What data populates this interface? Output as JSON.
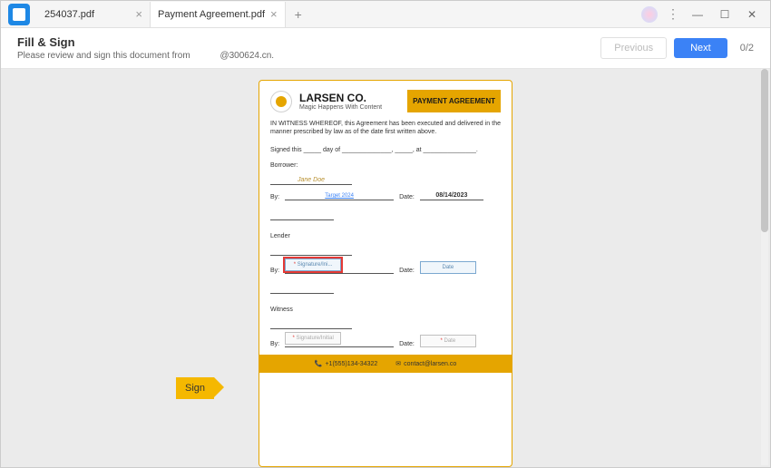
{
  "tabs": [
    {
      "label": "254037.pdf",
      "active": false
    },
    {
      "label": "Payment Agreement.pdf",
      "active": true
    }
  ],
  "header": {
    "title": "Fill & Sign",
    "subtitle_prefix": "Please review and sign this document from",
    "subtitle_suffix": "@300624.cn.",
    "prev_label": "Previous",
    "next_label": "Next",
    "page_count": "0/2"
  },
  "sign_pointer": "Sign",
  "document": {
    "company_name": "LARSEN CO.",
    "tagline": "Magic Happens With Content",
    "badge": "PAYMENT AGREEMENT",
    "intro": "IN WITNESS WHEREOF, this Agreement has been executed and delivered in the manner prescribed by law as of the date first written above.",
    "signed_line": "Signed this _____ day of ______________, _____, at _______________.",
    "borrower_label": "Borrower:",
    "borrower_name": "Jane Doe",
    "borrower_sig": "Target 2024",
    "borrower_date": "08/14/2023",
    "lender_label": "Lender",
    "lender_sig_placeholder": "Signature/Ini...",
    "lender_date_placeholder": "Date",
    "witness_label": "Witness",
    "witness_sig_placeholder": "Signature/Initial",
    "witness_date_placeholder": "Date",
    "by_label": "By:",
    "date_label": "Date:",
    "footer_phone": "+1(555)134-34322",
    "footer_email": "contact@larsen.co"
  }
}
